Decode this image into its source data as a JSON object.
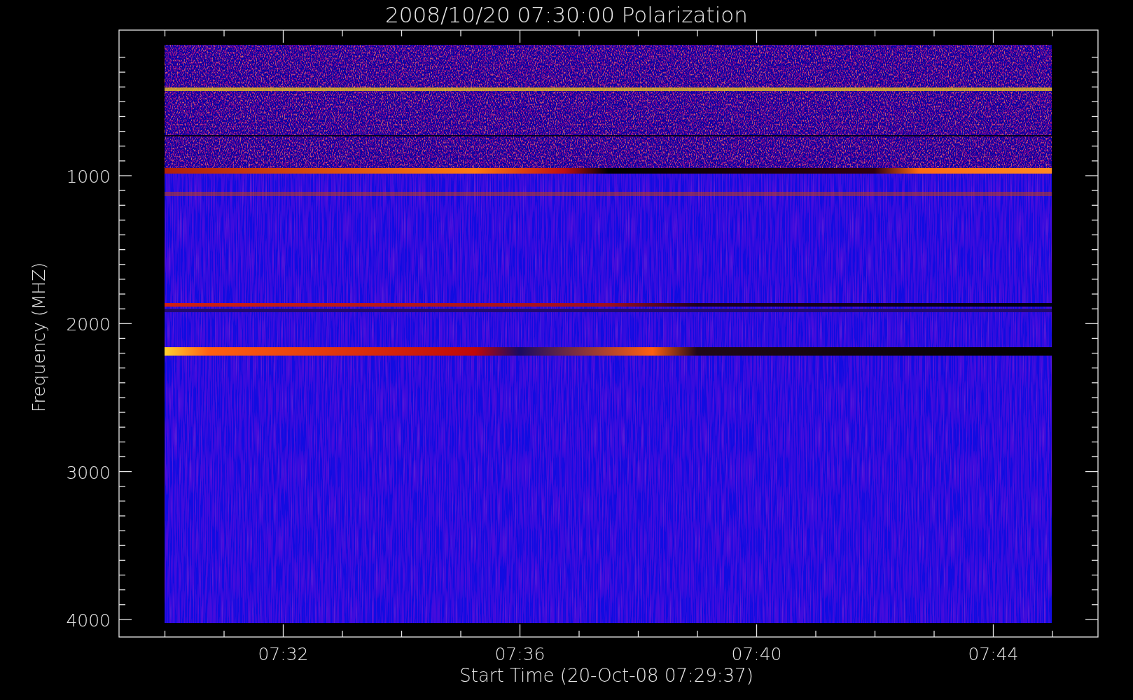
{
  "plot": {
    "title": "2008/10/20 07:30:00 Polarization",
    "xlabel": "Start Time (20-Oct-08 07:29:37)",
    "ylabel": "Frequency (MHZ)",
    "xticks": [
      "07:32",
      "07:36",
      "07:40",
      "07:44"
    ],
    "yticks": [
      "1000",
      "2000",
      "3000",
      "4000"
    ]
  }
}
